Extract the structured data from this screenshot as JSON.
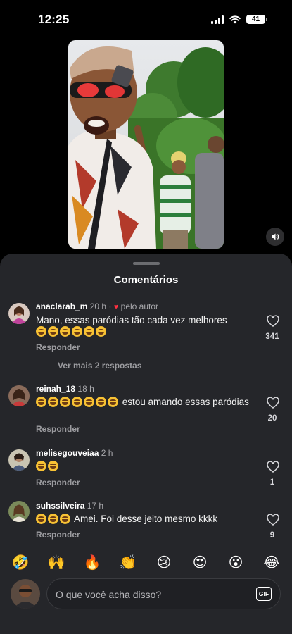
{
  "status_bar": {
    "time": "12:25",
    "battery": "41"
  },
  "sheet": {
    "title": "Comentários"
  },
  "comments": [
    {
      "username": "anaclarab_m",
      "time": "20 h",
      "author_note": "pelo autor",
      "text": "Mano, essas paródias tão cada vez melhores",
      "laugh_count": 6,
      "laugh_position": "after",
      "reply_label": "Responder",
      "likes": "341",
      "more_replies": "Ver mais 2 respostas"
    },
    {
      "username": "reinah_18",
      "time": "18 h",
      "text": "estou amando essas paródias",
      "laugh_count": 7,
      "laugh_position": "before",
      "reply_label": "Responder",
      "likes": "20"
    },
    {
      "username": "melisegouveiaa",
      "time": "2 h",
      "text": "",
      "laugh_count": 2,
      "laugh_position": "before",
      "reply_label": "Responder",
      "likes": "1"
    },
    {
      "username": "suhssilveira",
      "time": "17 h",
      "text": "Amei. Foi desse jeito mesmo kkkk",
      "laugh_count": 3,
      "laugh_position": "before",
      "reply_label": "Responder",
      "likes": "9"
    }
  ],
  "reactions": [
    "🤣",
    "🙌",
    "🔥",
    "👏",
    "😢",
    "😍",
    "😮",
    "😂"
  ],
  "composer": {
    "placeholder": "O que você acha disso?",
    "gif_label": "GIF"
  },
  "colors": {
    "sheet_bg": "#25262a",
    "heart": "#ff3040",
    "muted_text": "#9c9ca0"
  },
  "icons": {
    "like": "heart-outline-icon",
    "sound": "speaker-icon",
    "gif": "gif-icon"
  }
}
